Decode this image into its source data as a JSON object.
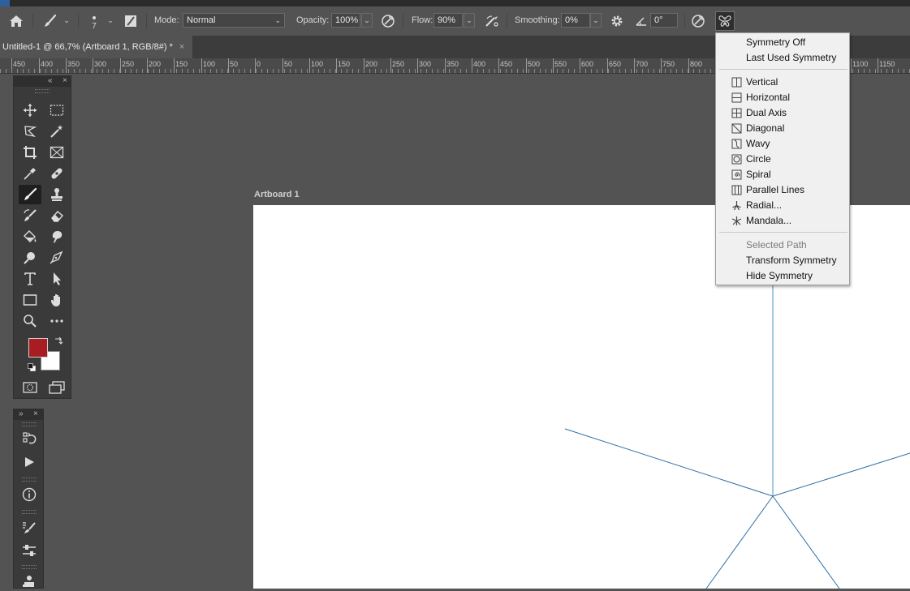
{
  "options_bar": {
    "brush_size": "7",
    "mode_label": "Mode:",
    "mode_value": "Normal",
    "opacity_label": "Opacity:",
    "opacity_value": "100%",
    "flow_label": "Flow:",
    "flow_value": "90%",
    "smoothing_label": "Smoothing:",
    "smoothing_value": "0%",
    "angle_value": "0°",
    "icons": [
      "home-icon",
      "brush-icon",
      "brush-preset-icon",
      "brush-settings-icon",
      "pressure-opacity-icon",
      "airbrush-icon",
      "gear-icon",
      "angle-icon",
      "pressure-size-icon",
      "symmetry-butterfly-icon"
    ]
  },
  "document_tab": {
    "title": "Untitled-1 @ 66,7% (Artboard 1, RGB/8#) *",
    "close": "×"
  },
  "ruler": {
    "labels": [
      "450",
      "400",
      "350",
      "300",
      "250",
      "200",
      "150",
      "100",
      "50",
      "0",
      "50",
      "100",
      "150",
      "200",
      "250",
      "300",
      "350",
      "400",
      "450",
      "500",
      "550",
      "600",
      "650",
      "700",
      "750",
      "800",
      "1100",
      "1150"
    ]
  },
  "artboard": {
    "label": "Artboard 1",
    "background": "#ffffff"
  },
  "tools_panel": {
    "foreground_color": "#a81c22",
    "background_color": "#ffffff",
    "tools": [
      "move-tool-icon",
      "marquee-tool-icon",
      "lasso-tool-icon",
      "magic-wand-icon",
      "crop-tool-icon",
      "frame-tool-icon",
      "eyedropper-icon",
      "healing-brush-icon",
      "brush-tool-icon",
      "clone-stamp-icon",
      "history-brush-icon",
      "eraser-icon",
      "paint-bucket-icon",
      "smudge-icon",
      "dodge-icon",
      "pen-tool-icon",
      "type-tool-icon",
      "path-selection-icon",
      "rectangle-tool-icon",
      "hand-tool-icon",
      "zoom-tool-icon",
      "more-tools-icon",
      "quick-mask-icon",
      "screen-mode-icon"
    ]
  },
  "symmetry_menu": {
    "group1": [
      {
        "label": "Symmetry Off"
      },
      {
        "label": "Last Used Symmetry"
      }
    ],
    "group2": [
      {
        "label": "Vertical",
        "icon": "vertical-symmetry-icon"
      },
      {
        "label": "Horizontal",
        "icon": "horizontal-symmetry-icon"
      },
      {
        "label": "Dual Axis",
        "icon": "dual-axis-symmetry-icon"
      },
      {
        "label": "Diagonal",
        "icon": "diagonal-symmetry-icon"
      },
      {
        "label": "Wavy",
        "icon": "wavy-symmetry-icon"
      },
      {
        "label": "Circle",
        "icon": "circle-symmetry-icon"
      },
      {
        "label": "Spiral",
        "icon": "spiral-symmetry-icon"
      },
      {
        "label": "Parallel Lines",
        "icon": "parallel-lines-symmetry-icon"
      },
      {
        "label": "Radial...",
        "icon": "radial-symmetry-icon"
      },
      {
        "label": "Mandala...",
        "icon": "mandala-symmetry-icon"
      }
    ],
    "group3": [
      {
        "label": "Selected Path",
        "disabled": true
      },
      {
        "label": "Transform Symmetry"
      },
      {
        "label": "Hide Symmetry"
      }
    ]
  },
  "colors": {
    "ui_background": "#535353",
    "panel_dark": "#3a3a3a",
    "symmetry_line": "#2f6fa6"
  }
}
